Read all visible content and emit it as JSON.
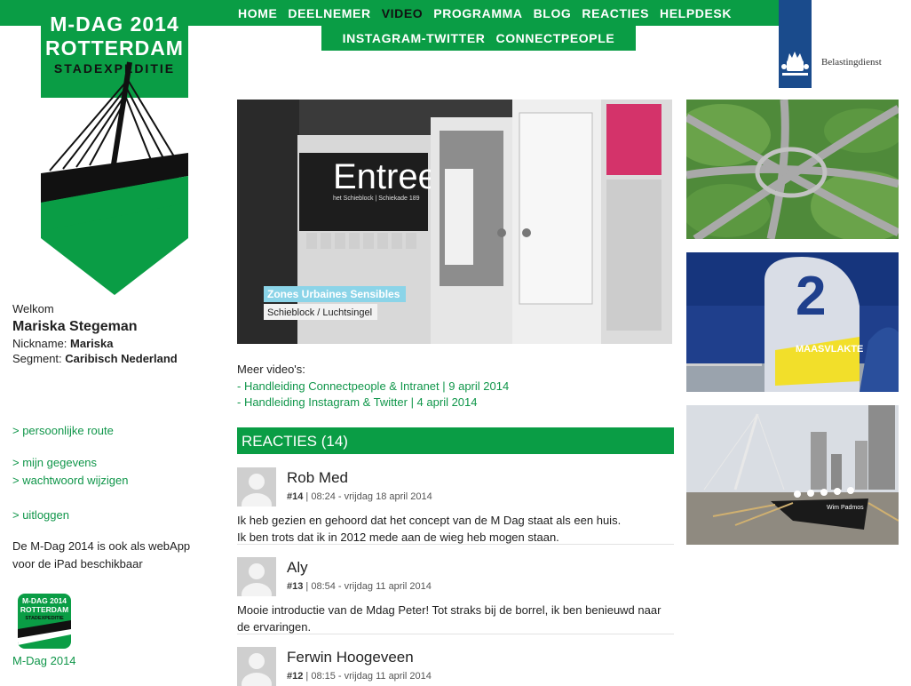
{
  "nav": {
    "row1": [
      "HOME",
      "DEELNEMER",
      "VIDEO",
      "PROGRAMMA",
      "BLOG",
      "REACTIES",
      "HELPDESK"
    ],
    "row2": [
      "INSTAGRAM-TWITTER",
      "CONNECTPEOPLE"
    ],
    "active": "VIDEO"
  },
  "logo": {
    "line1": "M-DAG 2014",
    "line2": "ROTTERDAM",
    "line3": "STADEXPEDITIE"
  },
  "sponsor": {
    "name": "Belastingdienst"
  },
  "sidebar": {
    "welcome": "Welkom",
    "user_name": "Mariska Stegeman",
    "nickname_label": "Nickname:",
    "nickname": "Mariska",
    "segment_label": "Segment:",
    "segment": "Caribisch Nederland",
    "links": {
      "route": "> persoonlijke route",
      "gegevens": "> mijn gegevens",
      "wachtwoord": "> wachtwoord wijzigen",
      "uitloggen": "> uitloggen"
    },
    "webapp_note": "De M-Dag 2014 is ook als webApp voor de iPad beschikbaar",
    "app_label": "M-Dag 2014",
    "app_icon_line1": "M-DAG 2014",
    "app_icon_line2": "ROTTERDAM",
    "app_icon_line3": "STADEXPEDITIE"
  },
  "video": {
    "sign_text": "Entree",
    "sign_sub": "het Schieblock | Schiekade 189",
    "caption_title": "Zones Urbaines Sensibles",
    "caption_sub": "Schieblock / Luchtsingel"
  },
  "more_videos": {
    "label": "Meer video's:",
    "links": [
      "- Handleiding Connectpeople & Intranet | 9 april 2014",
      "- Handleiding Instagram & Twitter | 4 april 2014"
    ]
  },
  "reacties": {
    "header": "REACTIES (14)",
    "items": [
      {
        "name": "Rob Med",
        "num": "#14",
        "meta": " | 08:24 - vrijdag 18 april 2014",
        "text": "Ik heb gezien en gehoord dat het concept van de M Dag staat als een huis.\nIk ben trots dat ik in 2012 mede aan de wieg heb mogen staan."
      },
      {
        "name": "Aly",
        "num": "#13",
        "meta": " | 08:54 - vrijdag 11 april 2014",
        "text": "Mooie introductie van de Mdag Peter! Tot straks bij de borrel, ik ben benieuwd naar de ervaringen."
      },
      {
        "name": "Ferwin Hoogeveen",
        "num": "#12",
        "meta": " | 08:15 - vrijdag 11 april 2014",
        "text": ""
      }
    ]
  },
  "photos": {
    "maasvlakte_label": "MAASVLAKTE",
    "maasvlakte_number": "2",
    "boat_label": "Wim Padmos"
  },
  "colors": {
    "brand_green": "#0a9d45",
    "link_green": "#10964a",
    "sponsor_blue": "#1a4b8c"
  }
}
